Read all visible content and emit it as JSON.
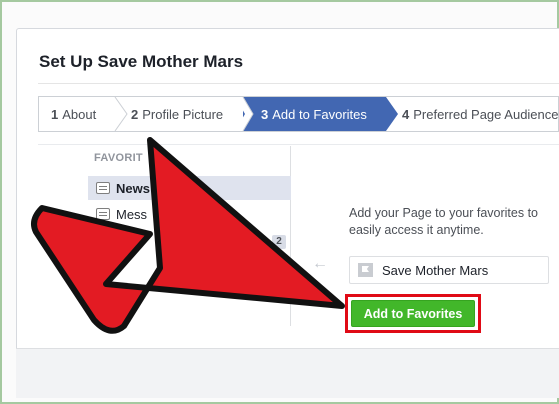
{
  "card": {
    "title": "Set Up Save Mother Mars"
  },
  "steps": [
    {
      "num": "1",
      "label": "About"
    },
    {
      "num": "2",
      "label": "Profile Picture"
    },
    {
      "num": "3",
      "label": "Add to Favorites"
    },
    {
      "num": "4",
      "label": "Preferred Page Audience"
    }
  ],
  "active_step": "3",
  "sidebar": {
    "heading": "FAVORIT",
    "items": [
      {
        "label": "News",
        "icon": "news-feed-icon"
      },
      {
        "label": "Mess",
        "icon": "messages-icon"
      }
    ],
    "badge": "2"
  },
  "main": {
    "description": "Add your Page to your favorites to easily access it anytime.",
    "preview_label": "Save Mother Mars",
    "add_button": "Add to Favorites"
  },
  "colors": {
    "accent": "#4267b2",
    "button": "#42b72a",
    "highlight": "#e00a16",
    "arrow": "#e31b23"
  }
}
